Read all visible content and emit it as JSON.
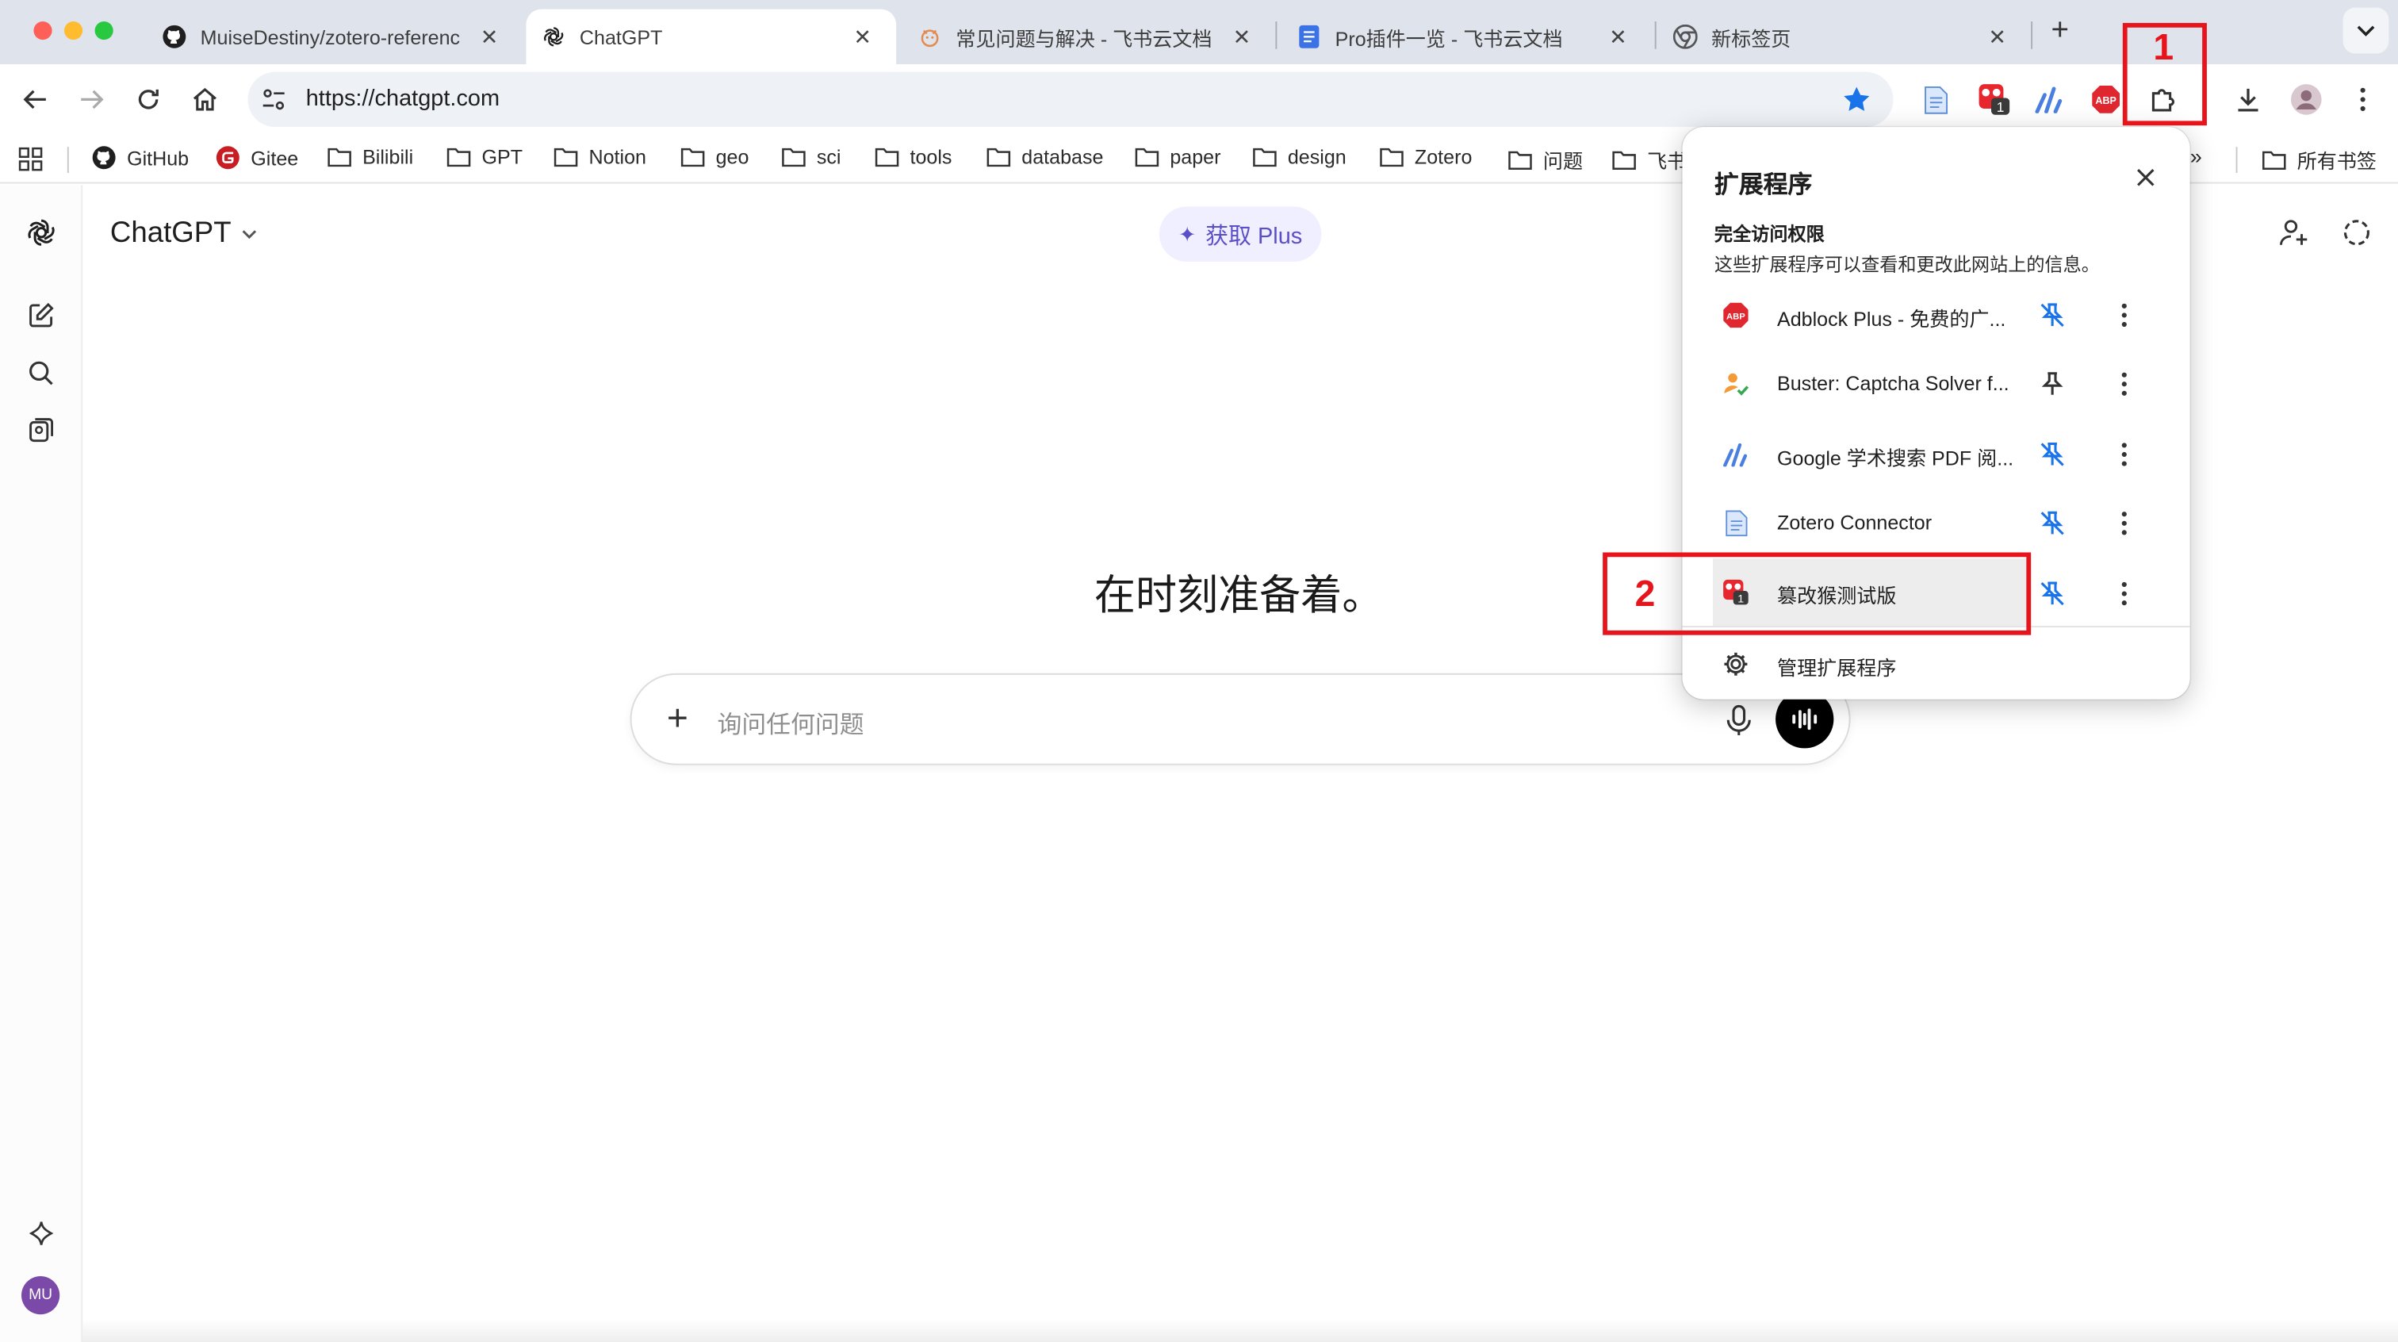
{
  "browser": {
    "tabs": [
      {
        "title": "MuiseDestiny/zotero-referenc",
        "icon": "github-icon",
        "active": false
      },
      {
        "title": "ChatGPT",
        "icon": "openai-icon",
        "active": true
      },
      {
        "title": "常见问题与解决 - 飞书云文档",
        "icon": "feishu-icon",
        "active": false
      },
      {
        "title": "Pro插件一览 - 飞书云文档",
        "icon": "doc-icon",
        "active": false
      },
      {
        "title": "新标签页",
        "icon": "chrome-icon",
        "active": false
      }
    ],
    "url": "https://chatgpt.com",
    "bookmarks": [
      "GitHub",
      "Gitee",
      "Bilibili",
      "GPT",
      "Notion",
      "geo",
      "sci",
      "tools",
      "database",
      "paper",
      "design",
      "Zotero",
      "问题",
      "飞书"
    ],
    "all_bookmarks_label": "所有书签",
    "toolbar_badge": "1"
  },
  "page": {
    "app_title": "ChatGPT",
    "plus_button": "获取 Plus",
    "hero_text": "在时刻准备着。",
    "composer_placeholder": "询问任何问题",
    "avatar_initials": "MU"
  },
  "extensions_popup": {
    "title": "扩展程序",
    "section_title": "完全访问权限",
    "section_desc": "这些扩展程序可以查看和更改此网站上的信息。",
    "items": [
      {
        "name": "Adblock Plus - 免费的广...",
        "icon": "adblock-icon",
        "pinned": true
      },
      {
        "name": "Buster: Captcha Solver f...",
        "icon": "buster-icon",
        "pinned": false
      },
      {
        "name": "Google 学术搜索 PDF 阅...",
        "icon": "scholar-icon",
        "pinned": true
      },
      {
        "name": "Zotero Connector",
        "icon": "zotero-icon",
        "pinned": true
      },
      {
        "name": "篡改猴测试版",
        "icon": "tampermonkey-icon",
        "pinned": true
      }
    ],
    "manage_label": "管理扩展程序",
    "badge": "1"
  },
  "annotations": [
    "1",
    "2"
  ],
  "colors": {
    "accent_blue": "#1a73e8",
    "annotation_red": "#e8141b",
    "plus_purple": "#5b4ec7"
  }
}
